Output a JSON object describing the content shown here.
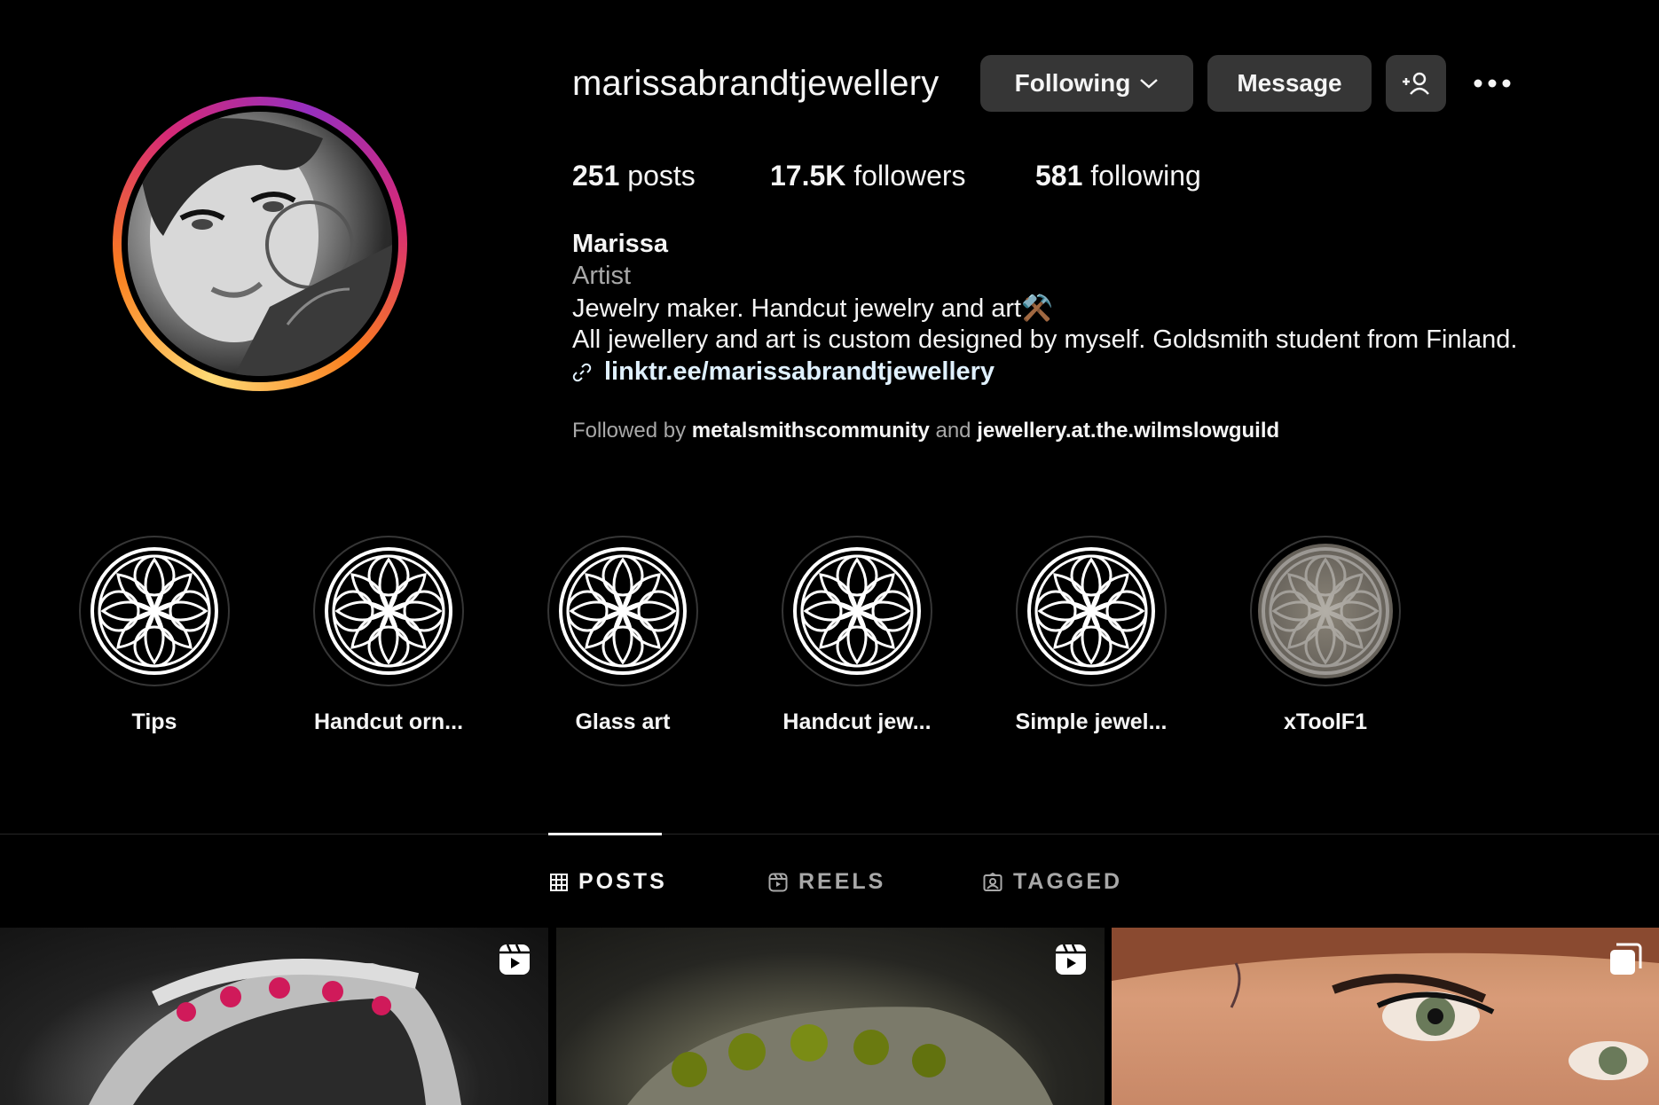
{
  "profile": {
    "username": "marissabrandtjewellery",
    "buttons": {
      "following": "Following",
      "message": "Message"
    },
    "stats": {
      "posts_count": "251",
      "posts_label": "posts",
      "followers_count": "17.5K",
      "followers_label": "followers",
      "following_count": "581",
      "following_label": "following"
    },
    "name": "Marissa",
    "category": "Artist",
    "bio_line1": "Jewelry maker. Handcut jewelry and art⚒️",
    "bio_line2": "All jewellery and art is custom designed by myself. Goldsmith student from Finland.",
    "link": "linktr.ee/marissabrandtjewellery",
    "followed_by": {
      "prefix": "Followed by",
      "user1": "metalsmithscommunity",
      "conj": "and",
      "user2": "jewellery.at.the.wilmslowguild"
    }
  },
  "highlights": [
    {
      "label": "Tips"
    },
    {
      "label": "Handcut orn..."
    },
    {
      "label": "Glass art"
    },
    {
      "label": "Handcut jew..."
    },
    {
      "label": "Simple jewel..."
    },
    {
      "label": "xToolF1"
    }
  ],
  "tabs": {
    "posts": "POSTS",
    "reels": "REELS",
    "tagged": "TAGGED"
  },
  "posts": [
    {
      "type_icon": "reel-icon"
    },
    {
      "type_icon": "reel-icon"
    },
    {
      "type_icon": "carousel-icon"
    }
  ],
  "colors": {
    "background": "#000000",
    "button": "#363636",
    "muted_text": "#a8a8a8",
    "link": "#e0f1ff"
  }
}
